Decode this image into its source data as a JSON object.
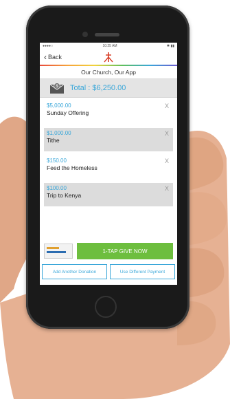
{
  "status": {
    "left": "●●●●○",
    "time": "10:25 AM",
    "right": "✱ ▮▮"
  },
  "nav": {
    "back_label": "Back"
  },
  "app": {
    "title": "Our Church, Our App"
  },
  "total": {
    "label": "Total : ",
    "amount": "$6,250.00"
  },
  "donations": [
    {
      "amount": "$5,000.00",
      "name": "Sunday Offering",
      "remove": "X"
    },
    {
      "amount": "$1,000.00",
      "name": "Tithe",
      "remove": "X"
    },
    {
      "amount": "$150.00",
      "name": "Feed the Homeless",
      "remove": "X"
    },
    {
      "amount": "$100.00",
      "name": "Trip to Kenya",
      "remove": "X"
    }
  ],
  "actions": {
    "give_now": "1-TAP GIVE NOW",
    "add_donation": "Add Another Donation",
    "use_payment": "Use Different Payment"
  },
  "colors": {
    "accent": "#3aa7d9",
    "give": "#6dbe3e",
    "shaded": "#dcdcdc"
  }
}
